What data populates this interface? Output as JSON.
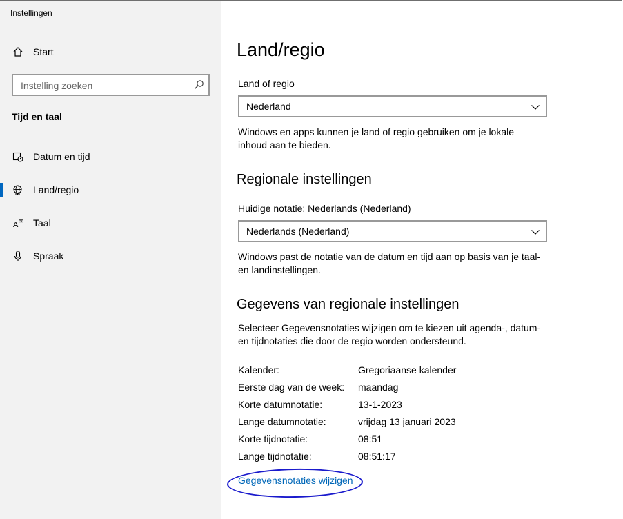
{
  "window": {
    "title": "Instellingen"
  },
  "sidebar": {
    "home_label": "Start",
    "search_placeholder": "Instelling zoeken",
    "section_title": "Tijd en taal",
    "items": [
      {
        "label": "Datum en tijd",
        "icon": "calendar-clock-icon"
      },
      {
        "label": "Land/regio",
        "icon": "globe-icon",
        "active": true
      },
      {
        "label": "Taal",
        "icon": "language-icon"
      },
      {
        "label": "Spraak",
        "icon": "microphone-icon"
      }
    ]
  },
  "main": {
    "title": "Land/regio",
    "country_label": "Land of regio",
    "country_value": "Nederland",
    "country_desc": "Windows en apps kunnen je land of regio gebruiken om je lokale inhoud aan te bieden.",
    "regional_heading": "Regionale instellingen",
    "format_label": "Huidige notatie: Nederlands (Nederland)",
    "format_value": "Nederlands (Nederland)",
    "format_desc": "Windows past de notatie van de datum en tijd aan op basis van je taal- en landinstellingen.",
    "data_heading": "Gegevens van regionale instellingen",
    "data_desc": "Selecteer Gegevensnotaties wijzigen om te kiezen uit agenda-, datum- en tijdnotaties die door de regio worden ondersteund.",
    "rows": [
      {
        "key": "Kalender:",
        "value": "Gregoriaanse kalender"
      },
      {
        "key": "Eerste dag van de week:",
        "value": "maandag"
      },
      {
        "key": "Korte datumnotatie:",
        "value": "13-1-2023"
      },
      {
        "key": "Lange datumnotatie:",
        "value": "vrijdag 13 januari 2023"
      },
      {
        "key": "Korte tijdnotatie:",
        "value": "08:51"
      },
      {
        "key": "Lange tijdnotatie:",
        "value": "08:51:17"
      }
    ],
    "change_link": "Gegevensnotaties wijzigen"
  },
  "colors": {
    "accent": "#0067c0",
    "link": "#0067b8",
    "annotation": "#1a1acc",
    "sidebar_bg": "#f2f2f2"
  }
}
